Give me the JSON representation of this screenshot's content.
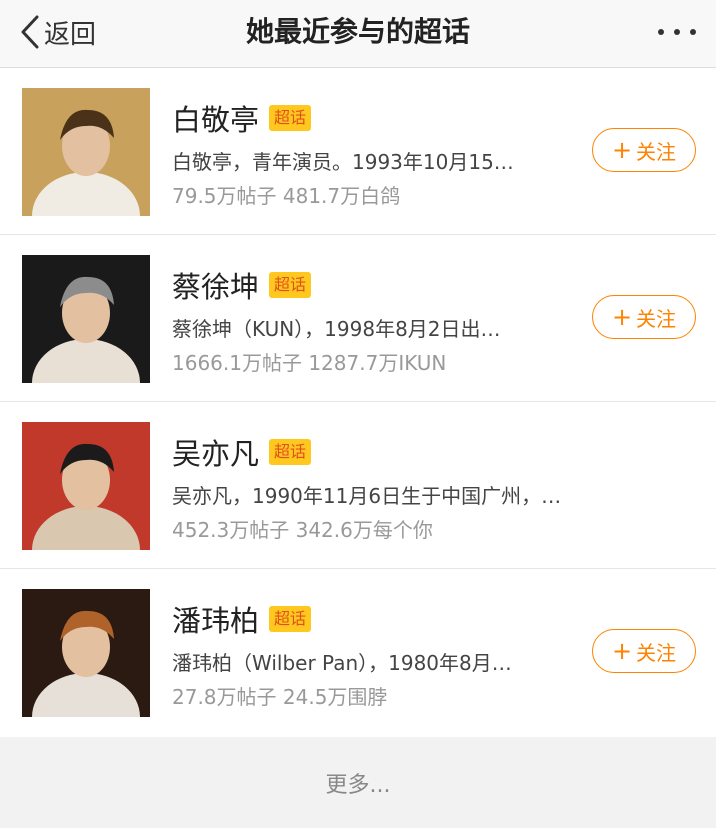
{
  "nav": {
    "back_label": "返回",
    "title": "她最近参与的超话",
    "more_icon": "more-horizontal-icon"
  },
  "badge_label": "超话",
  "follow_label": "关注",
  "items": [
    {
      "name": "白敬亭",
      "desc": "白敬亭，青年演员。1993年10月15…",
      "stats": "79.5万帖子 481.7万白鸽",
      "followable": true,
      "avatar_colors": [
        "#c8a15d",
        "#4a3218",
        "#f1ece3"
      ]
    },
    {
      "name": "蔡徐坤",
      "desc": "蔡徐坤（KUN），1998年8月2日出…",
      "stats": "1666.1万帖子 1287.7万IKUN",
      "followable": true,
      "avatar_colors": [
        "#1a1a1a",
        "#8c8c8c",
        "#e8e0d4"
      ]
    },
    {
      "name": "吴亦凡",
      "desc": "吴亦凡，1990年11月6日生于中国广州，演员、…",
      "stats": "452.3万帖子 342.6万每个你",
      "followable": false,
      "avatar_colors": [
        "#c0392b",
        "#1b1b1b",
        "#d9c7b0"
      ]
    },
    {
      "name": "潘玮柏",
      "desc": "潘玮柏（Wilber Pan），1980年8月…",
      "stats": "27.8万帖子 24.5万围脖",
      "followable": true,
      "avatar_colors": [
        "#2a1a12",
        "#b0622b",
        "#e6e0d8"
      ]
    }
  ],
  "footer": {
    "more_label": "更多..."
  }
}
